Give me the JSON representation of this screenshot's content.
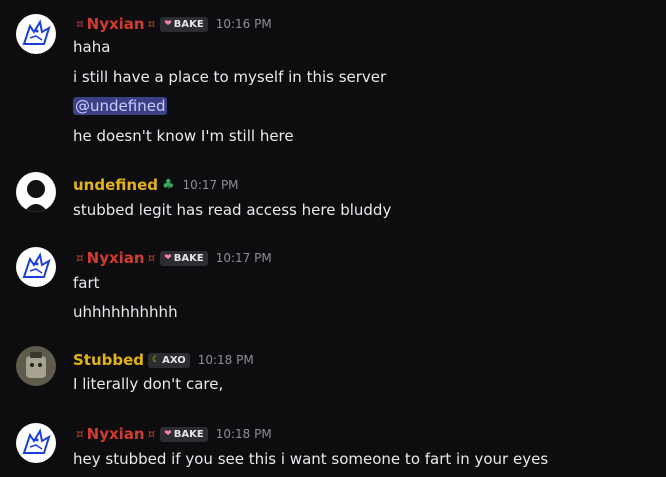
{
  "messages": [
    {
      "author": "Nyxian",
      "author_color": "#d23b2f",
      "decoration": "¤",
      "tag": "BAKE",
      "tag_icon": "heart-icon",
      "time": "10:16 PM",
      "lines": [
        "haha",
        "i still have a place to myself in this server",
        "@undefined",
        "he doesn't know I'm still here"
      ]
    },
    {
      "author": "undefined",
      "author_color": "#e3b31b",
      "badge_icon": "leaf-icon",
      "time": "10:17 PM",
      "lines": [
        "stubbed legit has read access here bluddy"
      ]
    },
    {
      "author": "Nyxian",
      "author_color": "#d23b2f",
      "decoration": "¤",
      "tag": "BAKE",
      "tag_icon": "heart-icon",
      "time": "10:17 PM",
      "lines": [
        "fart",
        "uhhhhhhhhhh"
      ]
    },
    {
      "author": "Stubbed",
      "author_color": "#e3b31b",
      "tag": "AXO",
      "tag_icon": "moon-icon",
      "time": "10:18 PM",
      "lines": [
        "I literally don't care,"
      ]
    },
    {
      "author": "Nyxian",
      "author_color": "#d23b2f",
      "decoration": "¤",
      "tag": "BAKE",
      "tag_icon": "heart-icon",
      "time": "10:18 PM",
      "lines": [
        "hey stubbed if you see this i want someone to fart in your eyes"
      ]
    }
  ]
}
